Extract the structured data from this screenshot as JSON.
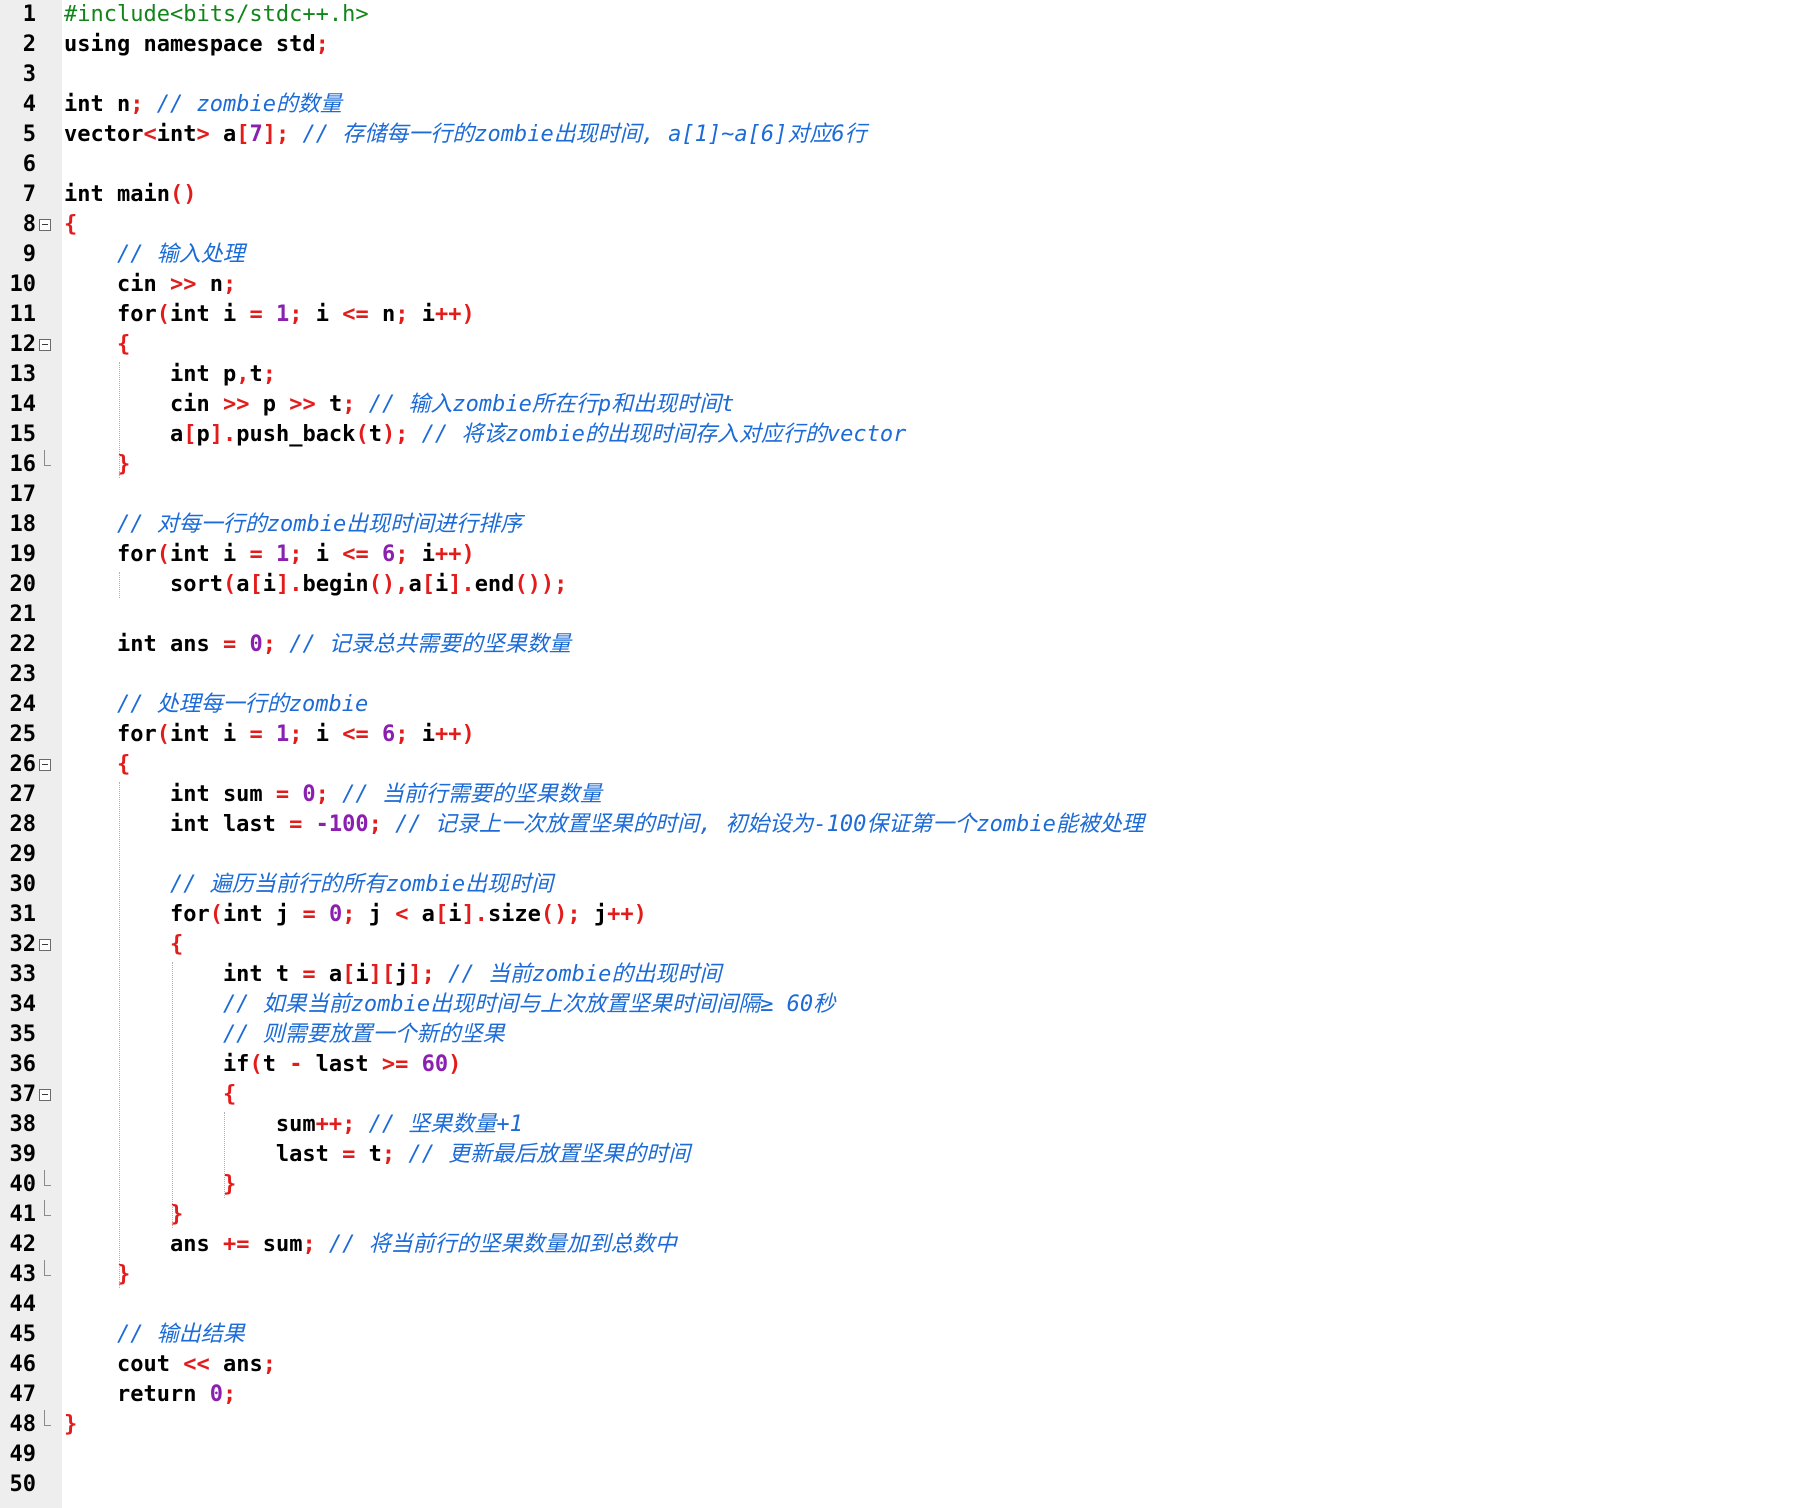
{
  "editor": {
    "lines": [
      {
        "n": "1",
        "tokens": [
          {
            "t": "#include<bits/stdc++.h>",
            "c": "pp"
          }
        ]
      },
      {
        "n": "2",
        "tokens": [
          {
            "t": "using namespace std",
            "c": "kw"
          },
          {
            "t": ";",
            "c": "op"
          }
        ]
      },
      {
        "n": "3",
        "tokens": []
      },
      {
        "n": "4",
        "tokens": [
          {
            "t": "int n",
            "c": "kw"
          },
          {
            "t": ";",
            "c": "op"
          },
          {
            "t": " // zombie的数量",
            "c": "cm"
          }
        ]
      },
      {
        "n": "5",
        "tokens": [
          {
            "t": "vector",
            "c": "id"
          },
          {
            "t": "<",
            "c": "op"
          },
          {
            "t": "int",
            "c": "kw"
          },
          {
            "t": ">",
            "c": "op"
          },
          {
            "t": " a",
            "c": "id"
          },
          {
            "t": "[",
            "c": "op"
          },
          {
            "t": "7",
            "c": "num"
          },
          {
            "t": "];",
            "c": "op"
          },
          {
            "t": " // 存储每一行的zombie出现时间, a[1]~a[6]对应6行",
            "c": "cm"
          }
        ]
      },
      {
        "n": "6",
        "tokens": []
      },
      {
        "n": "7",
        "tokens": [
          {
            "t": "int main",
            "c": "kw"
          },
          {
            "t": "()",
            "c": "op"
          }
        ]
      },
      {
        "n": "8",
        "fold": "open",
        "tokens": [
          {
            "t": "{",
            "c": "op"
          }
        ]
      },
      {
        "n": "9",
        "tokens": [
          {
            "t": "    // 输入处理",
            "c": "cm"
          }
        ]
      },
      {
        "n": "10",
        "tokens": [
          {
            "t": "    cin ",
            "c": "id"
          },
          {
            "t": ">>",
            "c": "op"
          },
          {
            "t": " n",
            "c": "id"
          },
          {
            "t": ";",
            "c": "op"
          }
        ]
      },
      {
        "n": "11",
        "tokens": [
          {
            "t": "    for",
            "c": "kw"
          },
          {
            "t": "(",
            "c": "op"
          },
          {
            "t": "int i ",
            "c": "kw"
          },
          {
            "t": "=",
            "c": "op"
          },
          {
            "t": " ",
            "c": "id"
          },
          {
            "t": "1",
            "c": "num"
          },
          {
            "t": ";",
            "c": "op"
          },
          {
            "t": " i ",
            "c": "id"
          },
          {
            "t": "<=",
            "c": "op"
          },
          {
            "t": " n",
            "c": "id"
          },
          {
            "t": ";",
            "c": "op"
          },
          {
            "t": " i",
            "c": "id"
          },
          {
            "t": "++)",
            "c": "op"
          }
        ]
      },
      {
        "n": "12",
        "fold": "open",
        "tokens": [
          {
            "t": "    {",
            "c": "op"
          }
        ]
      },
      {
        "n": "13",
        "tokens": [
          {
            "t": "        int p",
            "c": "kw"
          },
          {
            "t": ",",
            "c": "op"
          },
          {
            "t": "t",
            "c": "id"
          },
          {
            "t": ";",
            "c": "op"
          }
        ]
      },
      {
        "n": "14",
        "tokens": [
          {
            "t": "        cin ",
            "c": "id"
          },
          {
            "t": ">>",
            "c": "op"
          },
          {
            "t": " p ",
            "c": "id"
          },
          {
            "t": ">>",
            "c": "op"
          },
          {
            "t": " t",
            "c": "id"
          },
          {
            "t": ";",
            "c": "op"
          },
          {
            "t": " // 输入zombie所在行p和出现时间t",
            "c": "cm"
          }
        ]
      },
      {
        "n": "15",
        "tokens": [
          {
            "t": "        a",
            "c": "id"
          },
          {
            "t": "[",
            "c": "op"
          },
          {
            "t": "p",
            "c": "id"
          },
          {
            "t": "].",
            "c": "op"
          },
          {
            "t": "push_back",
            "c": "id"
          },
          {
            "t": "(",
            "c": "op"
          },
          {
            "t": "t",
            "c": "id"
          },
          {
            "t": ");",
            "c": "op"
          },
          {
            "t": " // 将该zombie的出现时间存入对应行的vector",
            "c": "cm"
          }
        ]
      },
      {
        "n": "16",
        "fold": "end",
        "tokens": [
          {
            "t": "    }",
            "c": "op"
          }
        ]
      },
      {
        "n": "17",
        "tokens": []
      },
      {
        "n": "18",
        "tokens": [
          {
            "t": "    // 对每一行的zombie出现时间进行排序",
            "c": "cm"
          }
        ]
      },
      {
        "n": "19",
        "tokens": [
          {
            "t": "    for",
            "c": "kw"
          },
          {
            "t": "(",
            "c": "op"
          },
          {
            "t": "int i ",
            "c": "kw"
          },
          {
            "t": "=",
            "c": "op"
          },
          {
            "t": " ",
            "c": "id"
          },
          {
            "t": "1",
            "c": "num"
          },
          {
            "t": ";",
            "c": "op"
          },
          {
            "t": " i ",
            "c": "id"
          },
          {
            "t": "<=",
            "c": "op"
          },
          {
            "t": " ",
            "c": "id"
          },
          {
            "t": "6",
            "c": "num"
          },
          {
            "t": ";",
            "c": "op"
          },
          {
            "t": " i",
            "c": "id"
          },
          {
            "t": "++)",
            "c": "op"
          }
        ]
      },
      {
        "n": "20",
        "tokens": [
          {
            "t": "        sort",
            "c": "id"
          },
          {
            "t": "(",
            "c": "op"
          },
          {
            "t": "a",
            "c": "id"
          },
          {
            "t": "[",
            "c": "op"
          },
          {
            "t": "i",
            "c": "id"
          },
          {
            "t": "].",
            "c": "op"
          },
          {
            "t": "begin",
            "c": "id"
          },
          {
            "t": "(),",
            "c": "op"
          },
          {
            "t": "a",
            "c": "id"
          },
          {
            "t": "[",
            "c": "op"
          },
          {
            "t": "i",
            "c": "id"
          },
          {
            "t": "].",
            "c": "op"
          },
          {
            "t": "end",
            "c": "id"
          },
          {
            "t": "());",
            "c": "op"
          }
        ]
      },
      {
        "n": "21",
        "tokens": []
      },
      {
        "n": "22",
        "tokens": [
          {
            "t": "    int ans ",
            "c": "kw"
          },
          {
            "t": "=",
            "c": "op"
          },
          {
            "t": " ",
            "c": "id"
          },
          {
            "t": "0",
            "c": "num"
          },
          {
            "t": ";",
            "c": "op"
          },
          {
            "t": " // 记录总共需要的坚果数量",
            "c": "cm"
          }
        ]
      },
      {
        "n": "23",
        "tokens": []
      },
      {
        "n": "24",
        "tokens": [
          {
            "t": "    // 处理每一行的zombie",
            "c": "cm"
          }
        ]
      },
      {
        "n": "25",
        "tokens": [
          {
            "t": "    for",
            "c": "kw"
          },
          {
            "t": "(",
            "c": "op"
          },
          {
            "t": "int i ",
            "c": "kw"
          },
          {
            "t": "=",
            "c": "op"
          },
          {
            "t": " ",
            "c": "id"
          },
          {
            "t": "1",
            "c": "num"
          },
          {
            "t": ";",
            "c": "op"
          },
          {
            "t": " i ",
            "c": "id"
          },
          {
            "t": "<=",
            "c": "op"
          },
          {
            "t": " ",
            "c": "id"
          },
          {
            "t": "6",
            "c": "num"
          },
          {
            "t": ";",
            "c": "op"
          },
          {
            "t": " i",
            "c": "id"
          },
          {
            "t": "++)",
            "c": "op"
          }
        ]
      },
      {
        "n": "26",
        "fold": "open",
        "tokens": [
          {
            "t": "    {",
            "c": "op"
          }
        ]
      },
      {
        "n": "27",
        "tokens": [
          {
            "t": "        int sum ",
            "c": "kw"
          },
          {
            "t": "=",
            "c": "op"
          },
          {
            "t": " ",
            "c": "id"
          },
          {
            "t": "0",
            "c": "num"
          },
          {
            "t": ";",
            "c": "op"
          },
          {
            "t": " // 当前行需要的坚果数量",
            "c": "cm"
          }
        ]
      },
      {
        "n": "28",
        "tokens": [
          {
            "t": "        int last ",
            "c": "kw"
          },
          {
            "t": "=",
            "c": "op"
          },
          {
            "t": " ",
            "c": "id"
          },
          {
            "t": "-100",
            "c": "num"
          },
          {
            "t": ";",
            "c": "op"
          },
          {
            "t": " // 记录上一次放置坚果的时间, 初始设为-100保证第一个zombie能被处理",
            "c": "cm"
          }
        ]
      },
      {
        "n": "29",
        "tokens": []
      },
      {
        "n": "30",
        "tokens": [
          {
            "t": "        // 遍历当前行的所有zombie出现时间",
            "c": "cm"
          }
        ]
      },
      {
        "n": "31",
        "tokens": [
          {
            "t": "        for",
            "c": "kw"
          },
          {
            "t": "(",
            "c": "op"
          },
          {
            "t": "int j ",
            "c": "kw"
          },
          {
            "t": "=",
            "c": "op"
          },
          {
            "t": " ",
            "c": "id"
          },
          {
            "t": "0",
            "c": "num"
          },
          {
            "t": ";",
            "c": "op"
          },
          {
            "t": " j ",
            "c": "id"
          },
          {
            "t": "<",
            "c": "op"
          },
          {
            "t": " a",
            "c": "id"
          },
          {
            "t": "[",
            "c": "op"
          },
          {
            "t": "i",
            "c": "id"
          },
          {
            "t": "].",
            "c": "op"
          },
          {
            "t": "size",
            "c": "id"
          },
          {
            "t": "();",
            "c": "op"
          },
          {
            "t": " j",
            "c": "id"
          },
          {
            "t": "++)",
            "c": "op"
          }
        ]
      },
      {
        "n": "32",
        "fold": "open",
        "tokens": [
          {
            "t": "        {",
            "c": "op"
          }
        ]
      },
      {
        "n": "33",
        "tokens": [
          {
            "t": "            int t ",
            "c": "kw"
          },
          {
            "t": "=",
            "c": "op"
          },
          {
            "t": " a",
            "c": "id"
          },
          {
            "t": "[",
            "c": "op"
          },
          {
            "t": "i",
            "c": "id"
          },
          {
            "t": "][",
            "c": "op"
          },
          {
            "t": "j",
            "c": "id"
          },
          {
            "t": "];",
            "c": "op"
          },
          {
            "t": " // 当前zombie的出现时间",
            "c": "cm"
          }
        ]
      },
      {
        "n": "34",
        "tokens": [
          {
            "t": "            // 如果当前zombie出现时间与上次放置坚果时间间隔≥ 60秒",
            "c": "cm"
          }
        ]
      },
      {
        "n": "35",
        "tokens": [
          {
            "t": "            // 则需要放置一个新的坚果",
            "c": "cm"
          }
        ]
      },
      {
        "n": "36",
        "tokens": [
          {
            "t": "            if",
            "c": "kw"
          },
          {
            "t": "(",
            "c": "op"
          },
          {
            "t": "t ",
            "c": "id"
          },
          {
            "t": "-",
            "c": "op"
          },
          {
            "t": " last ",
            "c": "id"
          },
          {
            "t": ">=",
            "c": "op"
          },
          {
            "t": " ",
            "c": "id"
          },
          {
            "t": "60",
            "c": "num"
          },
          {
            "t": ")",
            "c": "op"
          }
        ]
      },
      {
        "n": "37",
        "fold": "open",
        "tokens": [
          {
            "t": "            {",
            "c": "op"
          }
        ]
      },
      {
        "n": "38",
        "tokens": [
          {
            "t": "                sum",
            "c": "id"
          },
          {
            "t": "++;",
            "c": "op"
          },
          {
            "t": " // 坚果数量+1",
            "c": "cm"
          }
        ]
      },
      {
        "n": "39",
        "tokens": [
          {
            "t": "                last ",
            "c": "id"
          },
          {
            "t": "=",
            "c": "op"
          },
          {
            "t": " t",
            "c": "id"
          },
          {
            "t": ";",
            "c": "op"
          },
          {
            "t": " // 更新最后放置坚果的时间",
            "c": "cm"
          }
        ]
      },
      {
        "n": "40",
        "fold": "end",
        "tokens": [
          {
            "t": "            }",
            "c": "op"
          }
        ]
      },
      {
        "n": "41",
        "fold": "end",
        "tokens": [
          {
            "t": "        }",
            "c": "op"
          }
        ]
      },
      {
        "n": "42",
        "tokens": [
          {
            "t": "        ans ",
            "c": "id"
          },
          {
            "t": "+=",
            "c": "op"
          },
          {
            "t": " sum",
            "c": "id"
          },
          {
            "t": ";",
            "c": "op"
          },
          {
            "t": " // 将当前行的坚果数量加到总数中",
            "c": "cm"
          }
        ]
      },
      {
        "n": "43",
        "fold": "end",
        "tokens": [
          {
            "t": "    }",
            "c": "op"
          }
        ]
      },
      {
        "n": "44",
        "tokens": []
      },
      {
        "n": "45",
        "tokens": [
          {
            "t": "    // 输出结果",
            "c": "cm"
          }
        ]
      },
      {
        "n": "46",
        "tokens": [
          {
            "t": "    cout ",
            "c": "id"
          },
          {
            "t": "<<",
            "c": "op"
          },
          {
            "t": " ans",
            "c": "id"
          },
          {
            "t": ";",
            "c": "op"
          }
        ]
      },
      {
        "n": "47",
        "tokens": [
          {
            "t": "    return ",
            "c": "kw"
          },
          {
            "t": "0",
            "c": "num"
          },
          {
            "t": ";",
            "c": "op"
          }
        ]
      },
      {
        "n": "48",
        "fold": "end",
        "tokens": [
          {
            "t": "}",
            "c": "op"
          }
        ]
      },
      {
        "n": "49",
        "tokens": []
      },
      {
        "n": "50",
        "tokens": []
      }
    ]
  },
  "colors": {
    "keyword": "#000000",
    "operator": "#e31b1b",
    "number": "#8a1fb0",
    "preprocessor": "#12851a",
    "comment": "#1c6bd6",
    "gutter_bg": "#eeeeee"
  }
}
